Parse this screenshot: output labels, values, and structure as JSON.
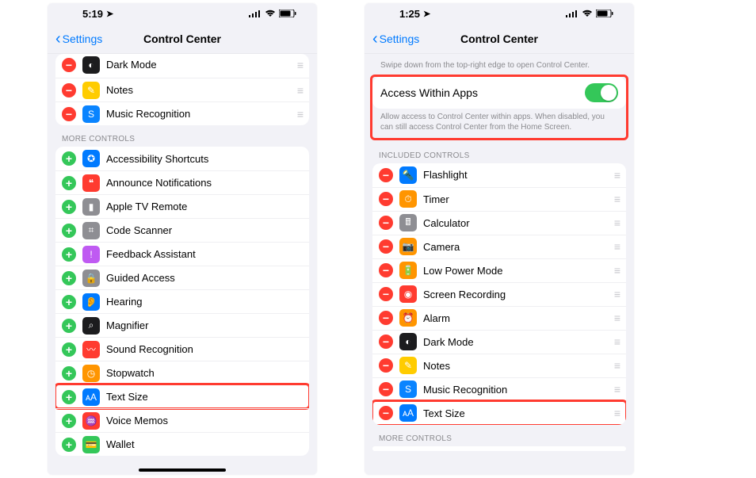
{
  "left": {
    "status": {
      "time": "5:19",
      "indicators": [
        "signal",
        "wifi",
        "battery"
      ]
    },
    "nav": {
      "back": "Settings",
      "title": "Control Center"
    },
    "partial_rows": [
      {
        "label": "Dark Mode",
        "icon_bg": "#1c1c1e",
        "icon_glyph": "◐",
        "action": "remove",
        "drag": true
      },
      {
        "label": "Notes",
        "icon_bg": "#ffcc00",
        "icon_glyph": "✎",
        "action": "remove",
        "drag": true
      },
      {
        "label": "Music Recognition",
        "icon_bg": "#0a84ff",
        "icon_glyph": "S",
        "action": "remove",
        "drag": true
      }
    ],
    "more_header": "MORE CONTROLS",
    "more_rows": [
      {
        "label": "Accessibility Shortcuts",
        "icon_bg": "#007aff",
        "icon_glyph": "✪"
      },
      {
        "label": "Announce Notifications",
        "icon_bg": "#ff3b30",
        "icon_glyph": "❝"
      },
      {
        "label": "Apple TV Remote",
        "icon_bg": "#8e8e93",
        "icon_glyph": "▮"
      },
      {
        "label": "Code Scanner",
        "icon_bg": "#8e8e93",
        "icon_glyph": "⌗"
      },
      {
        "label": "Feedback Assistant",
        "icon_bg": "#bf5af2",
        "icon_glyph": "!"
      },
      {
        "label": "Guided Access",
        "icon_bg": "#8e8e93",
        "icon_glyph": "🔒"
      },
      {
        "label": "Hearing",
        "icon_bg": "#007aff",
        "icon_glyph": "👂"
      },
      {
        "label": "Magnifier",
        "icon_bg": "#1c1c1e",
        "icon_glyph": "⌕"
      },
      {
        "label": "Sound Recognition",
        "icon_bg": "#ff3b30",
        "icon_glyph": "〰"
      },
      {
        "label": "Stopwatch",
        "icon_bg": "#ff9500",
        "icon_glyph": "◷"
      },
      {
        "label": "Text Size",
        "icon_bg": "#007aff",
        "icon_glyph": "ᴀA",
        "highlight": true
      },
      {
        "label": "Voice Memos",
        "icon_bg": "#ff3b30",
        "icon_glyph": "♒"
      },
      {
        "label": "Wallet",
        "icon_bg": "#34c759",
        "icon_glyph": "💳"
      }
    ]
  },
  "right": {
    "status": {
      "time": "1:25",
      "indicators": [
        "signal",
        "wifi",
        "battery"
      ]
    },
    "nav": {
      "back": "Settings",
      "title": "Control Center"
    },
    "intro": "Swipe down from the top-right edge to open Control Center.",
    "access_label": "Access Within Apps",
    "access_toggle": true,
    "access_caption": "Allow access to Control Center within apps. When disabled, you can still access Control Center from the Home Screen.",
    "included_header": "INCLUDED CONTROLS",
    "included_rows": [
      {
        "label": "Flashlight",
        "icon_bg": "#007aff",
        "icon_glyph": "🔦"
      },
      {
        "label": "Timer",
        "icon_bg": "#ff9500",
        "icon_glyph": "⏱"
      },
      {
        "label": "Calculator",
        "icon_bg": "#8e8e93",
        "icon_glyph": "🖩"
      },
      {
        "label": "Camera",
        "icon_bg": "#ff9500",
        "icon_glyph": "📷"
      },
      {
        "label": "Low Power Mode",
        "icon_bg": "#ff9500",
        "icon_glyph": "🔋"
      },
      {
        "label": "Screen Recording",
        "icon_bg": "#ff3b30",
        "icon_glyph": "◉"
      },
      {
        "label": "Alarm",
        "icon_bg": "#ff9500",
        "icon_glyph": "⏰"
      },
      {
        "label": "Dark Mode",
        "icon_bg": "#1c1c1e",
        "icon_glyph": "◐"
      },
      {
        "label": "Notes",
        "icon_bg": "#ffcc00",
        "icon_glyph": "✎"
      },
      {
        "label": "Music Recognition",
        "icon_bg": "#0a84ff",
        "icon_glyph": "S"
      },
      {
        "label": "Text Size",
        "icon_bg": "#007aff",
        "icon_glyph": "ᴀA",
        "highlight": true
      }
    ],
    "more_header": "MORE CONTROLS"
  }
}
